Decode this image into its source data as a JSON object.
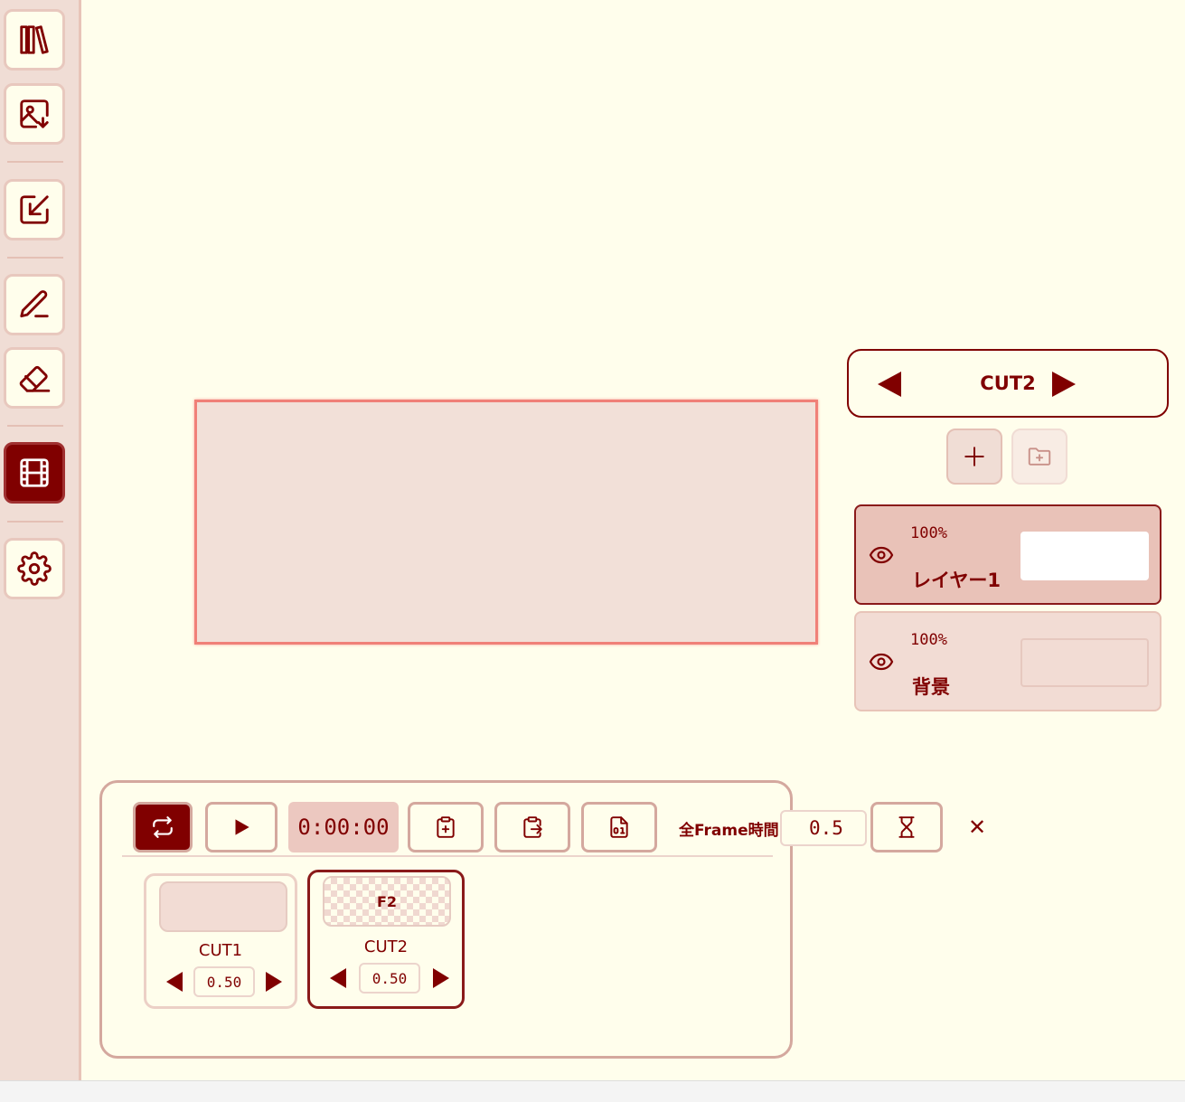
{
  "sidebar": {
    "tools": [
      {
        "name": "library-icon"
      },
      {
        "name": "image-import-icon"
      },
      {
        "name": "export-icon"
      },
      {
        "name": "pen-icon"
      },
      {
        "name": "eraser-icon"
      },
      {
        "name": "film-icon",
        "active": true
      },
      {
        "name": "gear-icon"
      }
    ]
  },
  "cut_nav": {
    "title": "CUT2"
  },
  "layer_actions": {
    "add_icon": "plus-icon",
    "add_folder_icon": "folder-plus-icon"
  },
  "layers": [
    {
      "opacity": "100%",
      "name": "レイヤー1",
      "selected": true
    },
    {
      "opacity": "100%",
      "name": "背景",
      "selected": false
    }
  ],
  "timeline": {
    "time": "0:00:00",
    "frame_time_label": "全Frame時間",
    "frame_time_value": "0.5",
    "close_label": "✕",
    "cuts": [
      {
        "label": "CUT1",
        "duration": "0.50",
        "thumb_label": "",
        "selected": false
      },
      {
        "label": "CUT2",
        "duration": "0.50",
        "thumb_label": "F2",
        "selected": true
      }
    ]
  },
  "colors": {
    "accent": "#800000",
    "background": "#fffeec",
    "sidebar": "#f0ddd5",
    "canvas_border": "#f08078"
  }
}
